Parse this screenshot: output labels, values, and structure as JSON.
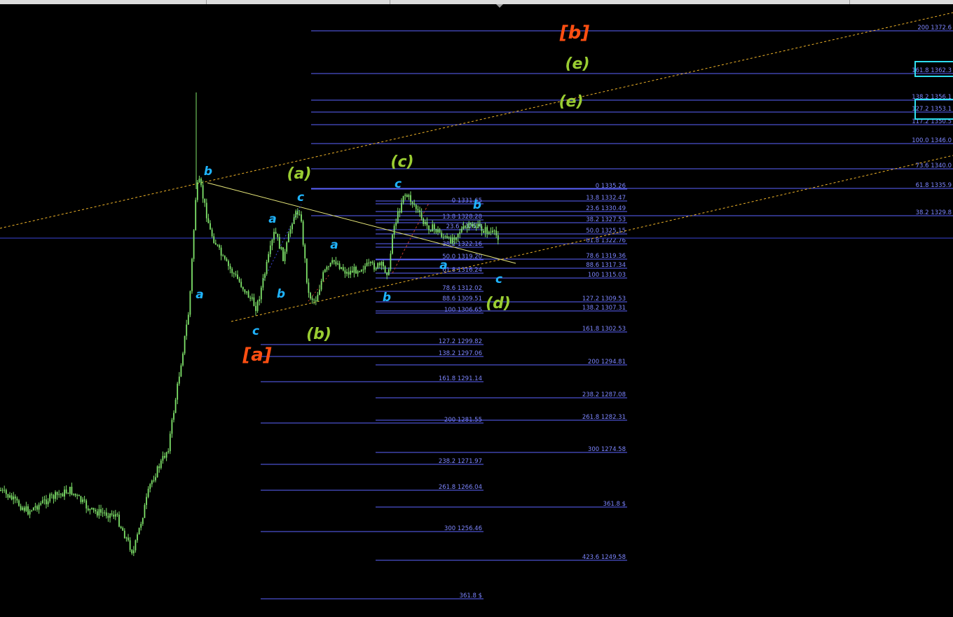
{
  "colors": {
    "background": "#000000",
    "candles": "#7fe36a",
    "fib_lines": "#5b63ff",
    "fib_text": "#7d86ff",
    "channel_lines": "#f0b429",
    "crosshair": "#3d46d6",
    "wave_small": "#1fb4ff",
    "wave_mid": "#9acd32",
    "wave_big": "#ff4f12",
    "highlight_box": "#2fe0f0"
  },
  "chart_data": {
    "type": "candlestick",
    "price_axis_visible": false,
    "fib_levels": [
      {
        "set": "A",
        "items": [
          {
            "ratio": "127.2",
            "price": "1299.82"
          },
          {
            "ratio": "138.2",
            "price": "1297.06"
          },
          {
            "ratio": "161.8",
            "price": "1291.14"
          },
          {
            "ratio": "200",
            "price": "1281.55"
          },
          {
            "ratio": "238.2",
            "price": "1271.97"
          },
          {
            "ratio": "261.8",
            "price": "1266.04"
          },
          {
            "ratio": "300",
            "price": "1256.46"
          },
          {
            "ratio": "361.8",
            "price": "$"
          }
        ]
      },
      {
        "set": "B",
        "items": [
          {
            "ratio": "0",
            "price": "1331.65"
          },
          {
            "ratio": "13.8",
            "price": "1328.28"
          },
          {
            "ratio": "23.6",
            "price": "1325.9"
          },
          {
            "ratio": "38.2",
            "price": "1322.16"
          },
          {
            "ratio": "50.0",
            "price": "1319.20"
          },
          {
            "ratio": "61.8",
            "price": "1316.24"
          },
          {
            "ratio": "78.6",
            "price": "1312.02"
          },
          {
            "ratio": "88.6",
            "price": "1309.51"
          },
          {
            "ratio": "100",
            "price": "1306.65"
          }
        ]
      },
      {
        "set": "C",
        "items": [
          {
            "ratio": "0",
            "price": "1335.26"
          },
          {
            "ratio": "13.8",
            "price": "1332.47"
          },
          {
            "ratio": "23.6",
            "price": "1330.49"
          },
          {
            "ratio": "38.2",
            "price": "1327.53"
          },
          {
            "ratio": "50.0",
            "price": "1325.15"
          },
          {
            "ratio": "61.8",
            "price": "1322.76"
          },
          {
            "ratio": "78.6",
            "price": "1319.36"
          },
          {
            "ratio": "88.6",
            "price": "1317.34"
          },
          {
            "ratio": "100",
            "price": "1315.03"
          },
          {
            "ratio": "127.2",
            "price": "1309.53"
          },
          {
            "ratio": "138.2",
            "price": "1307.31"
          },
          {
            "ratio": "161.8",
            "price": "1302.53"
          },
          {
            "ratio": "200",
            "price": "1294.81"
          },
          {
            "ratio": "238.2",
            "price": "1287.08"
          },
          {
            "ratio": "261.8",
            "price": "1282.31"
          },
          {
            "ratio": "300",
            "price": "1274.58"
          },
          {
            "ratio": "361.8",
            "price": "$"
          },
          {
            "ratio": "423.6",
            "price": "1249.58"
          }
        ]
      },
      {
        "set": "D",
        "items": [
          {
            "ratio": "200",
            "price": "1372.6"
          },
          {
            "ratio": "161.8",
            "price": "1362.3"
          },
          {
            "ratio": "138.2",
            "price": "1356.1"
          },
          {
            "ratio": "127.2",
            "price": "1353.1"
          },
          {
            "ratio": "117.2",
            "price": "1350.5"
          },
          {
            "ratio": "100.0",
            "price": "1346.0"
          },
          {
            "ratio": "73.6",
            "price": "1340.0"
          },
          {
            "ratio": "61.8",
            "price": "1335.9"
          },
          {
            "ratio": "38.2",
            "price": "1329.8"
          }
        ]
      }
    ],
    "wave_labels": {
      "small": [
        "b",
        "a",
        "c",
        "a",
        "b",
        "c",
        "a",
        "b",
        "c",
        "b",
        "a",
        "c"
      ],
      "mid": [
        "(a)",
        "(b)",
        "(c)",
        "(d)",
        "(e)",
        "(e)"
      ],
      "big": [
        "[a]",
        "[b]"
      ]
    }
  }
}
